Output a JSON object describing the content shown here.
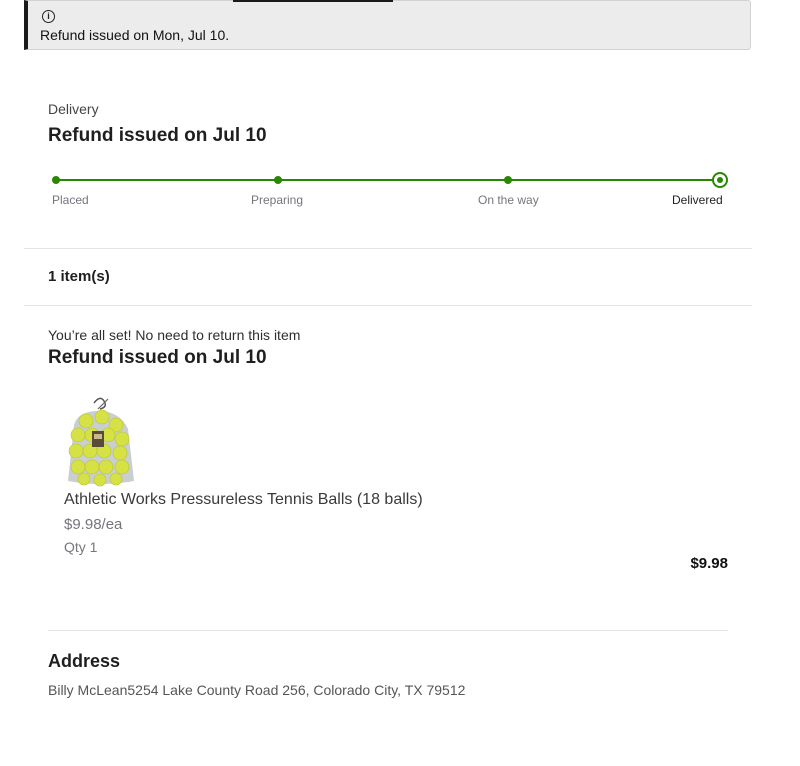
{
  "banner": {
    "icon": "info-icon",
    "icon_glyph": "i",
    "text": "Refund issued on Mon, Jul 10."
  },
  "delivery": {
    "label": "Delivery",
    "status": "Refund issued on Jul 10",
    "steps": [
      "Placed",
      "Preparing",
      "On the way",
      "Delivered"
    ],
    "current_step": "Delivered"
  },
  "items": {
    "count_label": "1 item(s)",
    "return_note": "You’re all set! No need to return this item",
    "refund_status": "Refund issued on Jul 10",
    "product": {
      "image": "tennis-balls-bag-image",
      "name": "Athletic Works Pressureless Tennis Balls (18 balls)",
      "unit_price": "$9.98/ea",
      "qty": "Qty 1",
      "total": "$9.98"
    }
  },
  "address": {
    "title": "Address",
    "text": "Billy McLean5254 Lake County Road 256, Colorado City, TX 79512"
  },
  "colors": {
    "progress": "#2a8703",
    "banner_bg": "#ececec",
    "banner_border": "#1a1a1a"
  }
}
